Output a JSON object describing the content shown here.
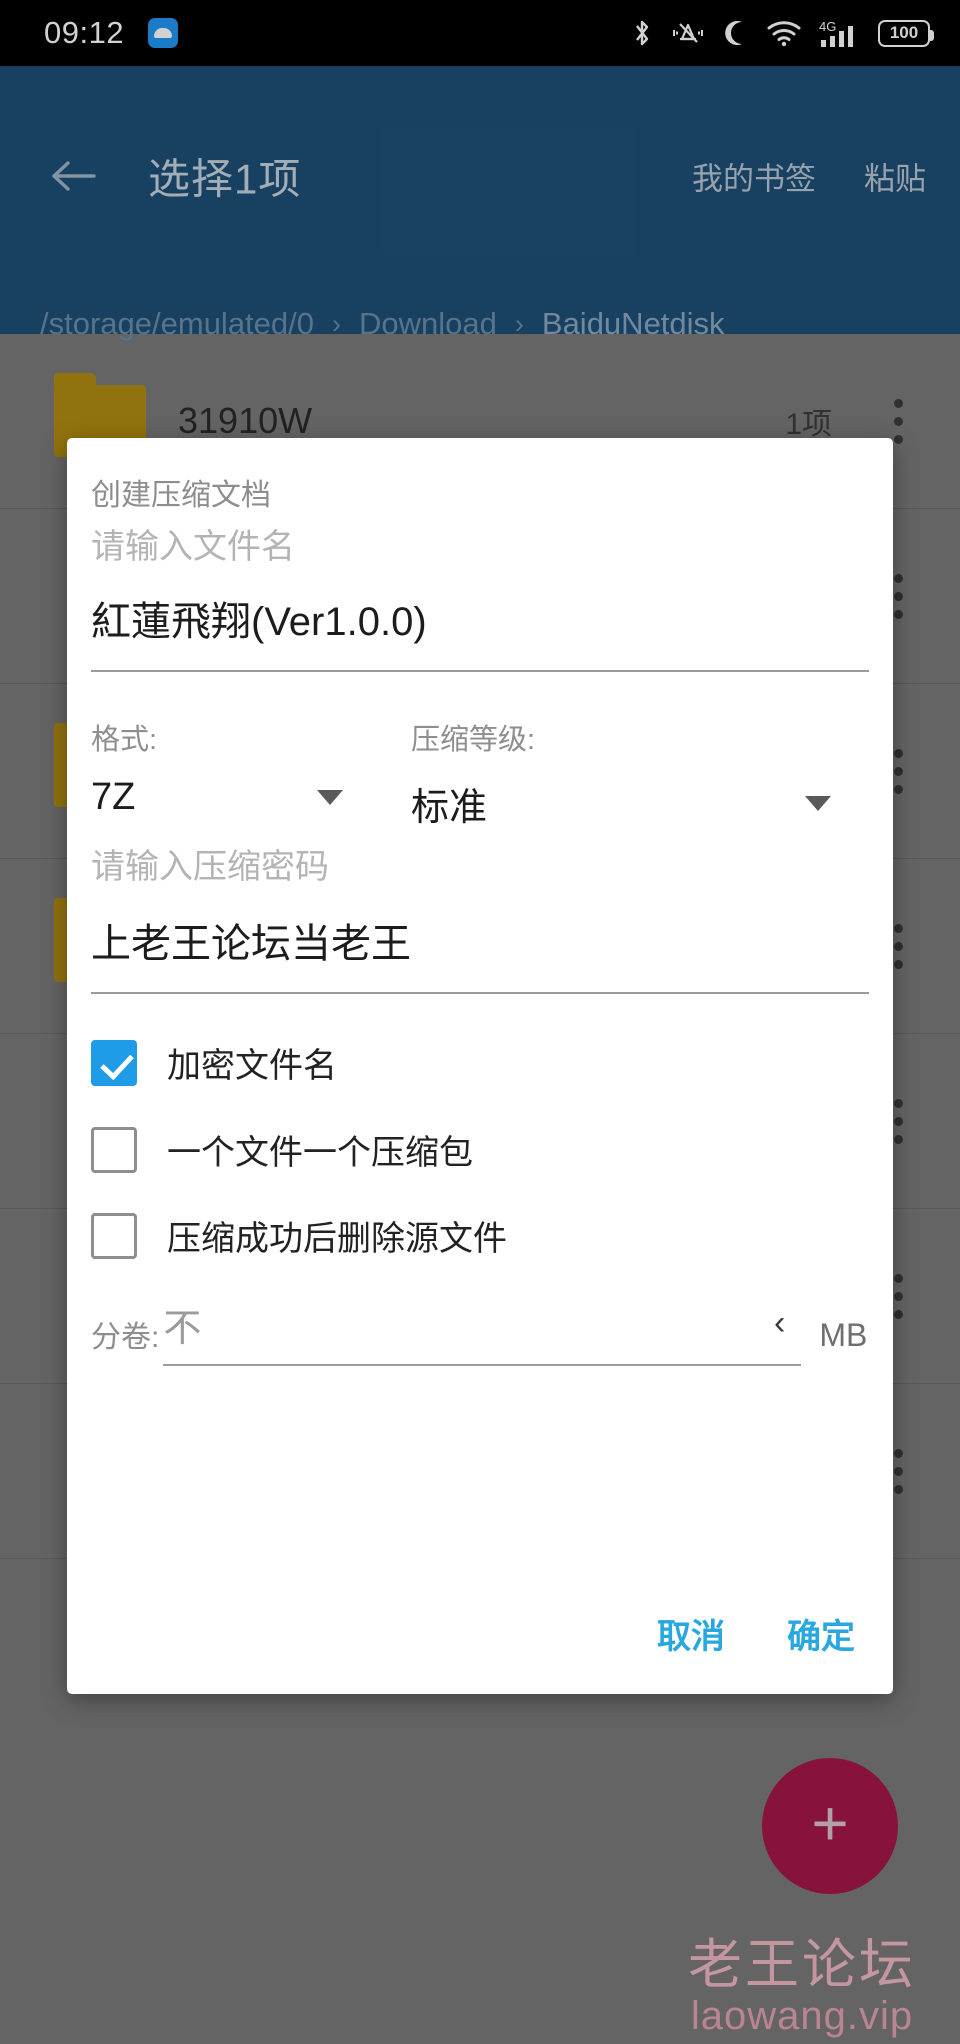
{
  "statusbar": {
    "time": "09:12",
    "app_icon": "android-app-icon",
    "icons": [
      "bluetooth-icon",
      "mute-bell-icon",
      "do-not-disturb-moon-icon",
      "wifi-icon",
      "signal-4g-icon"
    ],
    "network_label": "4G",
    "battery_level": "100"
  },
  "appbar": {
    "back_icon": "back-arrow-icon",
    "title": "选择1项",
    "actions": [
      {
        "label": "我的书签"
      },
      {
        "label": "粘贴"
      }
    ],
    "breadcrumb": {
      "separator": "›",
      "segments": [
        "/storage/emulated/0",
        "Download",
        "BaiduNetdisk"
      ]
    }
  },
  "filelist": {
    "rows": [
      {
        "icon": "folder-icon",
        "name": "31910W",
        "meta": "1项",
        "more": "overflow-menu-icon"
      },
      {
        "icon": "file-icon",
        "name": "",
        "meta": "",
        "more": "overflow-menu-icon"
      },
      {
        "icon": "folder-icon",
        "name": "",
        "meta": "",
        "more": "overflow-menu-icon"
      },
      {
        "icon": "folder-icon",
        "name": "",
        "meta": "",
        "more": "overflow-menu-icon"
      },
      {
        "icon": "file-icon",
        "name": "",
        "meta": "",
        "more": "overflow-menu-icon"
      },
      {
        "icon": "file-icon",
        "name": "",
        "meta": "",
        "more": "overflow-menu-icon"
      },
      {
        "icon": "file-icon",
        "name": "",
        "meta": "",
        "more": "overflow-menu-icon"
      }
    ]
  },
  "fab": {
    "icon": "plus-icon",
    "label": "+"
  },
  "watermark": {
    "cn": "老王论坛",
    "en": "laowang.vip"
  },
  "dialog": {
    "title": "创建压缩文档",
    "filename": {
      "placeholder": "请输入文件名",
      "value": "紅蓮飛翔(Ver1.0.0)"
    },
    "format": {
      "label": "格式:",
      "value": "7Z",
      "caret": "chevron-down-icon"
    },
    "level": {
      "label": "压缩等级:",
      "value": "标准",
      "caret": "chevron-down-icon"
    },
    "password": {
      "placeholder": "请输入压缩密码",
      "value": "上老王论坛当老王"
    },
    "checkboxes": [
      {
        "label": "加密文件名",
        "checked": true
      },
      {
        "label": "一个文件一个压缩包",
        "checked": false
      },
      {
        "label": "压缩成功后删除源文件",
        "checked": false
      }
    ],
    "split": {
      "label": "分卷:",
      "value": "不",
      "chevron": "‹",
      "unit": "MB"
    },
    "buttons": {
      "cancel": "取消",
      "confirm": "确定"
    }
  },
  "colors": {
    "appbar": "#1d4f77",
    "accent": "#29a7e0",
    "checkbox_on": "#1e9ce8",
    "fab": "#a5174a",
    "folder": "#b28c12",
    "watermark": "#f0b8c2"
  }
}
